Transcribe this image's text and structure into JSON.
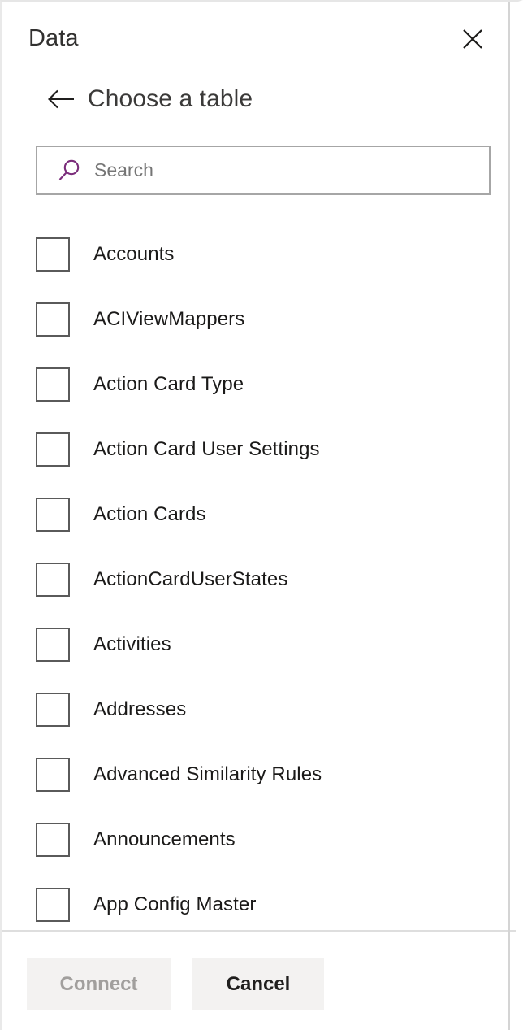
{
  "panel": {
    "title": "Data",
    "close_icon": "close-icon"
  },
  "subheader": {
    "back_icon": "arrow-left-icon",
    "title": "Choose a table"
  },
  "search": {
    "icon": "search-icon",
    "placeholder": "Search",
    "value": "",
    "icon_color": "#7b2d7b"
  },
  "list": {
    "items": [
      {
        "label": "Accounts",
        "checked": false
      },
      {
        "label": "ACIViewMappers",
        "checked": false
      },
      {
        "label": "Action Card Type",
        "checked": false
      },
      {
        "label": "Action Card User Settings",
        "checked": false
      },
      {
        "label": "Action Cards",
        "checked": false
      },
      {
        "label": "ActionCardUserStates",
        "checked": false
      },
      {
        "label": "Activities",
        "checked": false
      },
      {
        "label": "Addresses",
        "checked": false
      },
      {
        "label": "Advanced Similarity Rules",
        "checked": false
      },
      {
        "label": "Announcements",
        "checked": false
      },
      {
        "label": "App Config Master",
        "checked": false
      }
    ]
  },
  "footer": {
    "connect_label": "Connect",
    "connect_disabled": true,
    "cancel_label": "Cancel"
  },
  "colors": {
    "accent_purple": "#7b2d7b",
    "text_primary": "#1b1a19",
    "text_muted": "#757575",
    "button_bg": "#f3f2f1",
    "disabled_text": "#a19f9d",
    "border": "#a6a6a6"
  }
}
